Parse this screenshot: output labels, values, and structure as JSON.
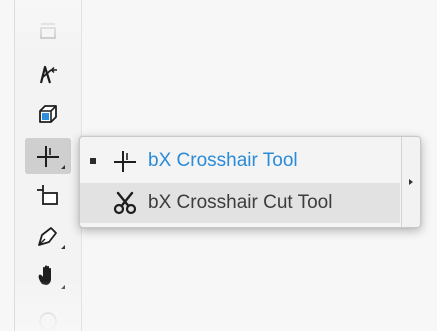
{
  "toolbar": {
    "tools": [
      {
        "icon": "artboard-icon"
      },
      {
        "icon": "direct-selection-arrow-icon"
      },
      {
        "icon": "3d-cube-icon"
      },
      {
        "icon": "crosshair-icon",
        "active": true
      },
      {
        "icon": "slice-rectangle-icon"
      },
      {
        "icon": "pen-icon"
      },
      {
        "icon": "hand-icon"
      },
      {
        "icon": "circle-icon"
      }
    ]
  },
  "flyout": {
    "items": [
      {
        "label": "bX Crosshair Tool",
        "icon": "crosshair-icon",
        "checked": true,
        "label_color": "#2a8bd8"
      },
      {
        "label": "bX Crosshair Cut Tool",
        "icon": "scissors-icon",
        "checked": false,
        "highlighted": true
      }
    ]
  }
}
